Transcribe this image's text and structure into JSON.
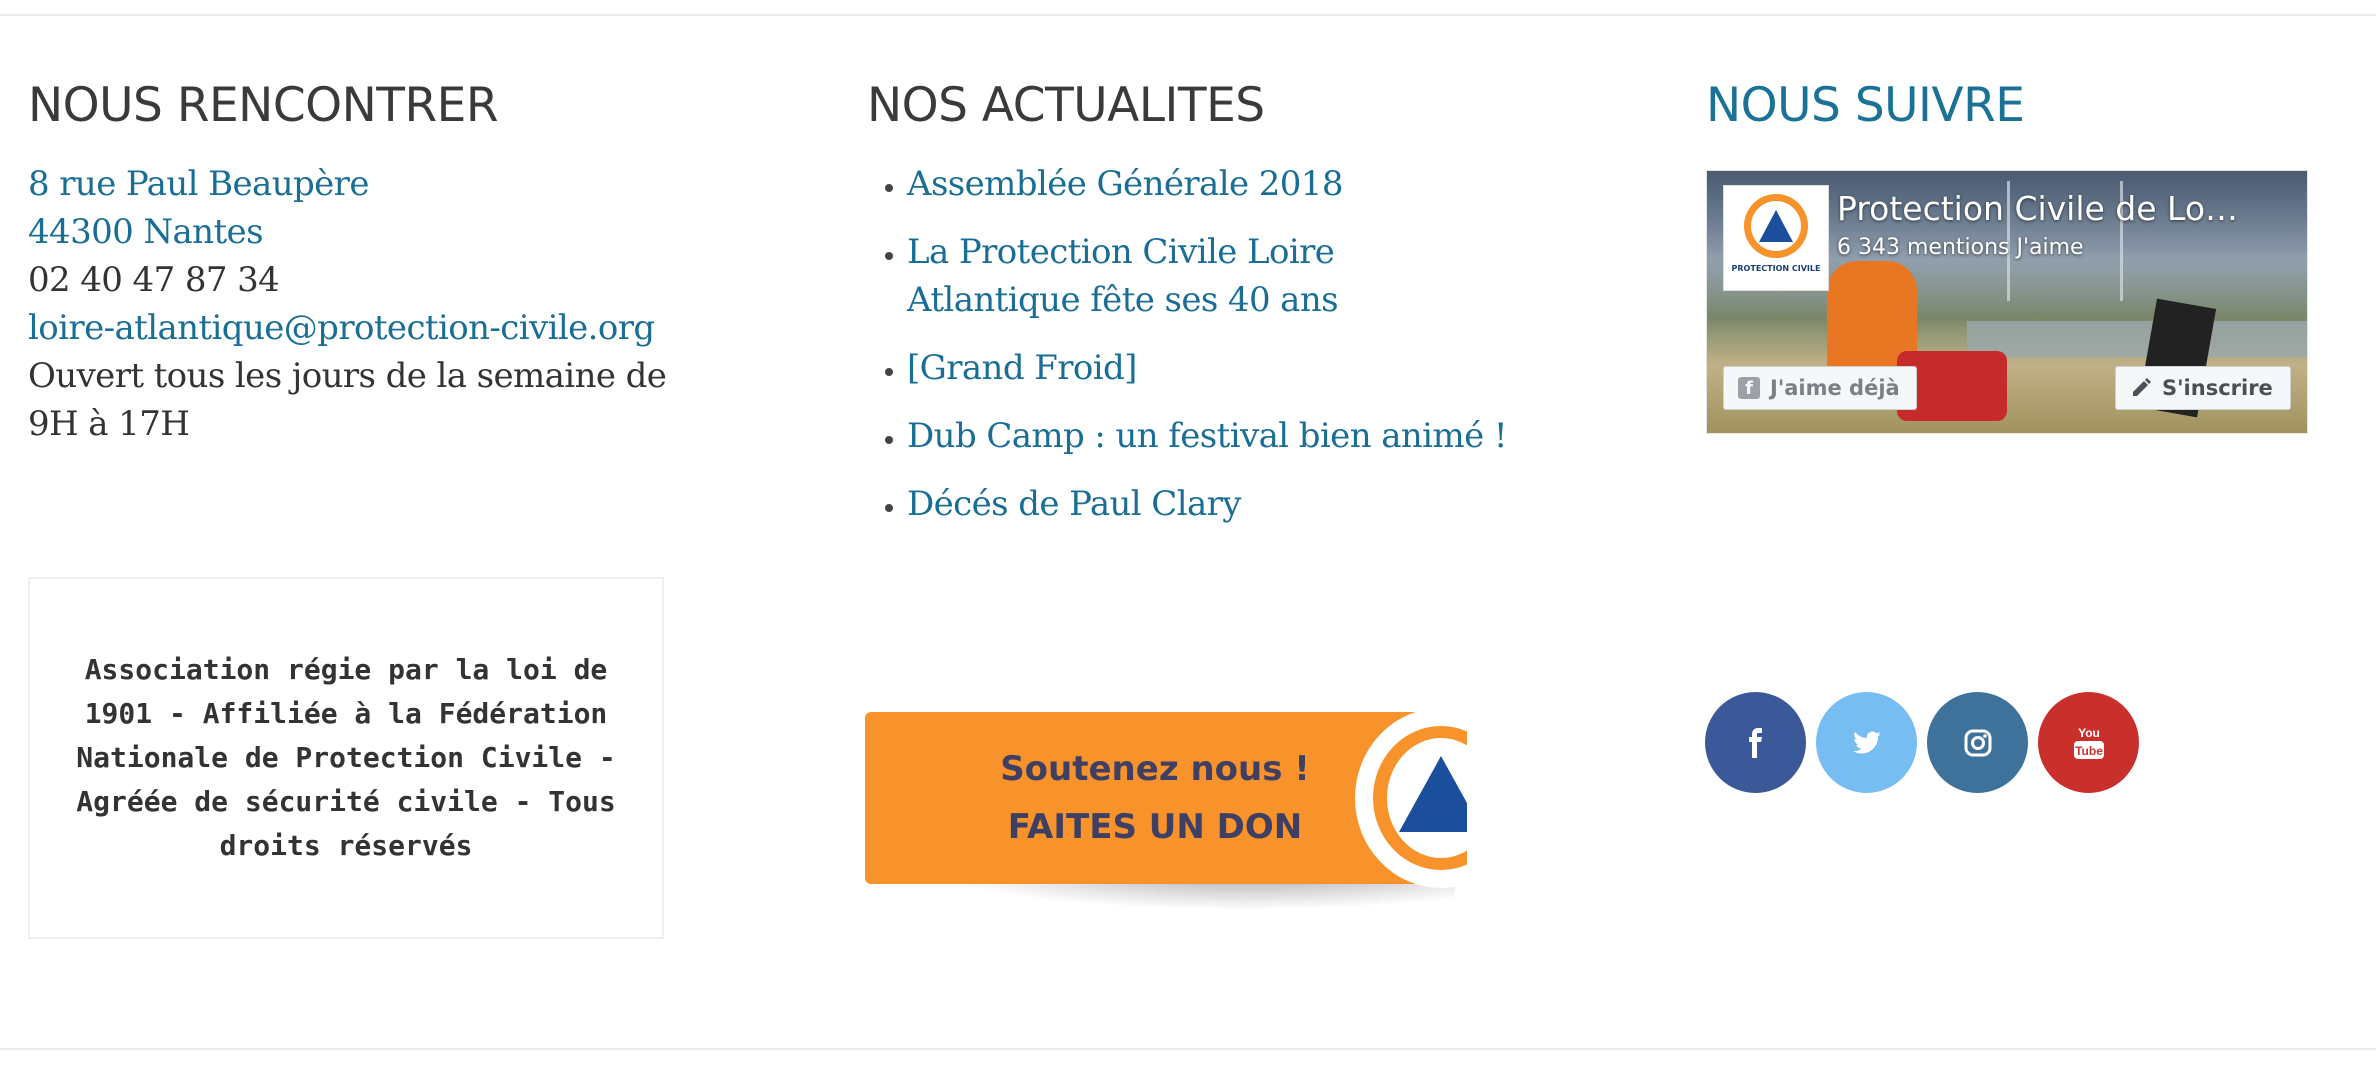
{
  "col_contact": {
    "heading": "NOUS RENCONTRER",
    "address_line1": "8 rue Paul Beaupère",
    "address_line2": "44300 Nantes",
    "phone": "02 40 47 87 34",
    "email": "loire-atlantique@protection-civile.org",
    "hours": "Ouvert tous les jours de la semaine de 9H à 17H",
    "legal": "Association régie par la loi de 1901 - Affiliée à la Fédération Nationale de Protection Civile - Agréée de sécurité civile - Tous droits réservés"
  },
  "col_news": {
    "heading": "NOS ACTUALITES",
    "items": [
      {
        "label": "Assemblée Générale 2018"
      },
      {
        "label": "La Protection Civile Loire Atlantique fête ses 40 ans"
      },
      {
        "label": "[Grand Froid]"
      },
      {
        "label": "Dub Camp : un festival bien animé !"
      },
      {
        "label": "Décés de Paul Clary"
      }
    ],
    "donate": {
      "line1": "Soutenez nous !",
      "line2": "FAITES UN DON"
    }
  },
  "col_follow": {
    "heading": "NOUS SUIVRE",
    "facebook": {
      "page_name": "Protection Civile de Lo…",
      "likes": "6 343 mentions J'aime",
      "logo_text": "PROTECTION CIVILE",
      "like_button": "J'aime déjà",
      "follow_button": "S'inscrire"
    },
    "socials": [
      {
        "name": "facebook",
        "color": "#3b5998"
      },
      {
        "name": "twitter",
        "color": "#76bdf1"
      },
      {
        "name": "instagram",
        "color": "#3f729b"
      },
      {
        "name": "youtube",
        "color": "#c9302c"
      }
    ]
  },
  "colors": {
    "link": "#1a6e96",
    "heading_accent": "#1a7296",
    "donate_orange": "#f7932a"
  }
}
